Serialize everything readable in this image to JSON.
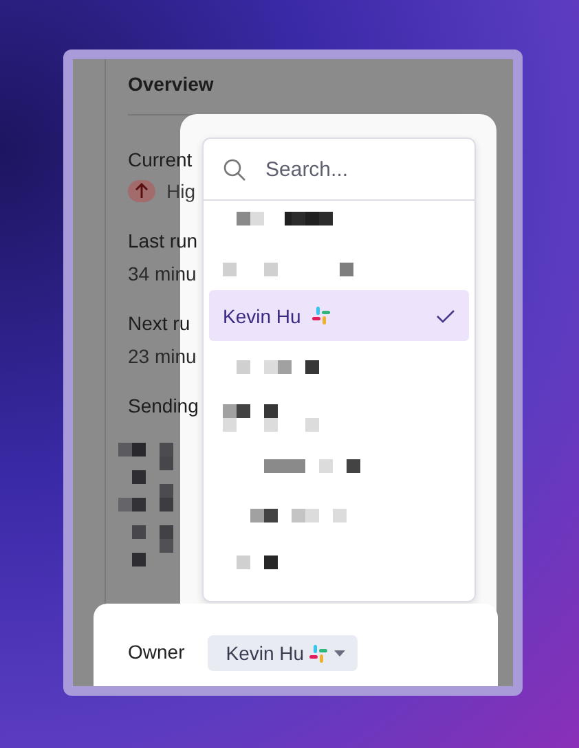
{
  "page": {
    "title": "Overview",
    "fields": [
      {
        "label": "Current",
        "value": "Hig",
        "kind": "priority"
      },
      {
        "label": "Last run",
        "value": "34 minu",
        "kind": "text"
      },
      {
        "label": "Next ru",
        "value": "23 minu",
        "kind": "text"
      },
      {
        "label": "Sending",
        "kind": "redacted"
      }
    ]
  },
  "dropdown": {
    "placeholder": "Search...",
    "options": [
      {
        "kind": "redacted",
        "selected": false
      },
      {
        "kind": "redacted",
        "selected": false
      },
      {
        "kind": "user",
        "name": "Kevin Hu",
        "selected": true
      },
      {
        "kind": "redacted",
        "selected": false
      },
      {
        "kind": "redacted",
        "selected": false
      },
      {
        "kind": "redacted",
        "selected": false
      },
      {
        "kind": "redacted",
        "selected": false
      },
      {
        "kind": "redacted",
        "selected": false
      }
    ]
  },
  "owner": {
    "label": "Owner",
    "value": "Kevin Hu"
  }
}
